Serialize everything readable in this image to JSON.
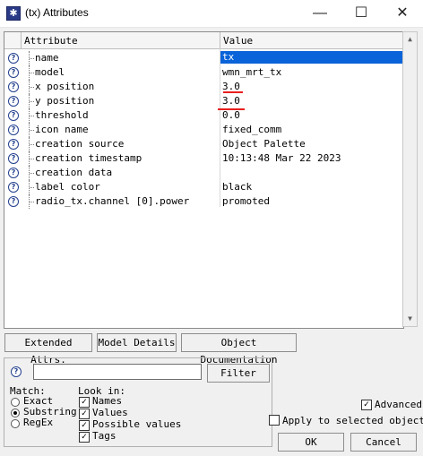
{
  "window": {
    "title": "(tx) Attributes",
    "icon_glyph": "✱",
    "controls": {
      "minimize": "—",
      "maximize": "☐",
      "close": "✕"
    }
  },
  "grid": {
    "headers": {
      "attribute": "Attribute",
      "value": "Value"
    },
    "help_glyph": "?",
    "rows": [
      {
        "name": "name",
        "value": "tx"
      },
      {
        "name": "model",
        "value": "wmn_mrt_tx"
      },
      {
        "name": "x position",
        "value": "3.0"
      },
      {
        "name": "y position",
        "value": "3.0"
      },
      {
        "name": "threshold",
        "value": "0.0"
      },
      {
        "name": "icon name",
        "value": "fixed_comm"
      },
      {
        "name": "creation source",
        "value": "Object Palette"
      },
      {
        "name": "creation timestamp",
        "value": "10:13:48 Mar 22 2023"
      },
      {
        "name": "creation data",
        "value": ""
      },
      {
        "name": "label color",
        "value": "black"
      },
      {
        "name": "radio_tx.channel [0].power",
        "value": "promoted"
      }
    ],
    "selected_row": "name",
    "annotation_color": "#e81f1f"
  },
  "buttons": {
    "extended_attrs": "Extended Attrs.",
    "model_details": "Model Details",
    "object_documentation": "Object Documentation",
    "filter": "Filter",
    "ok": "OK",
    "cancel": "Cancel"
  },
  "filter": {
    "help_glyph": "?",
    "input_value": "",
    "match_label": "Match:",
    "match_options": [
      "Exact",
      "Substring",
      "RegEx"
    ],
    "match_selected": "Substring",
    "look_in_label": "Look in:",
    "look_in_options": [
      {
        "label": "Names",
        "checked": true
      },
      {
        "label": "Values",
        "checked": true
      },
      {
        "label": "Possible values",
        "checked": true
      },
      {
        "label": "Tags",
        "checked": true
      }
    ]
  },
  "options": {
    "advanced": {
      "label": "Advanced",
      "checked": true
    },
    "apply_selected": {
      "label": "Apply to selected objects",
      "checked": false
    }
  },
  "check_glyph": "✓",
  "scroll_glyphs": {
    "up": "▲",
    "down": "▼"
  }
}
